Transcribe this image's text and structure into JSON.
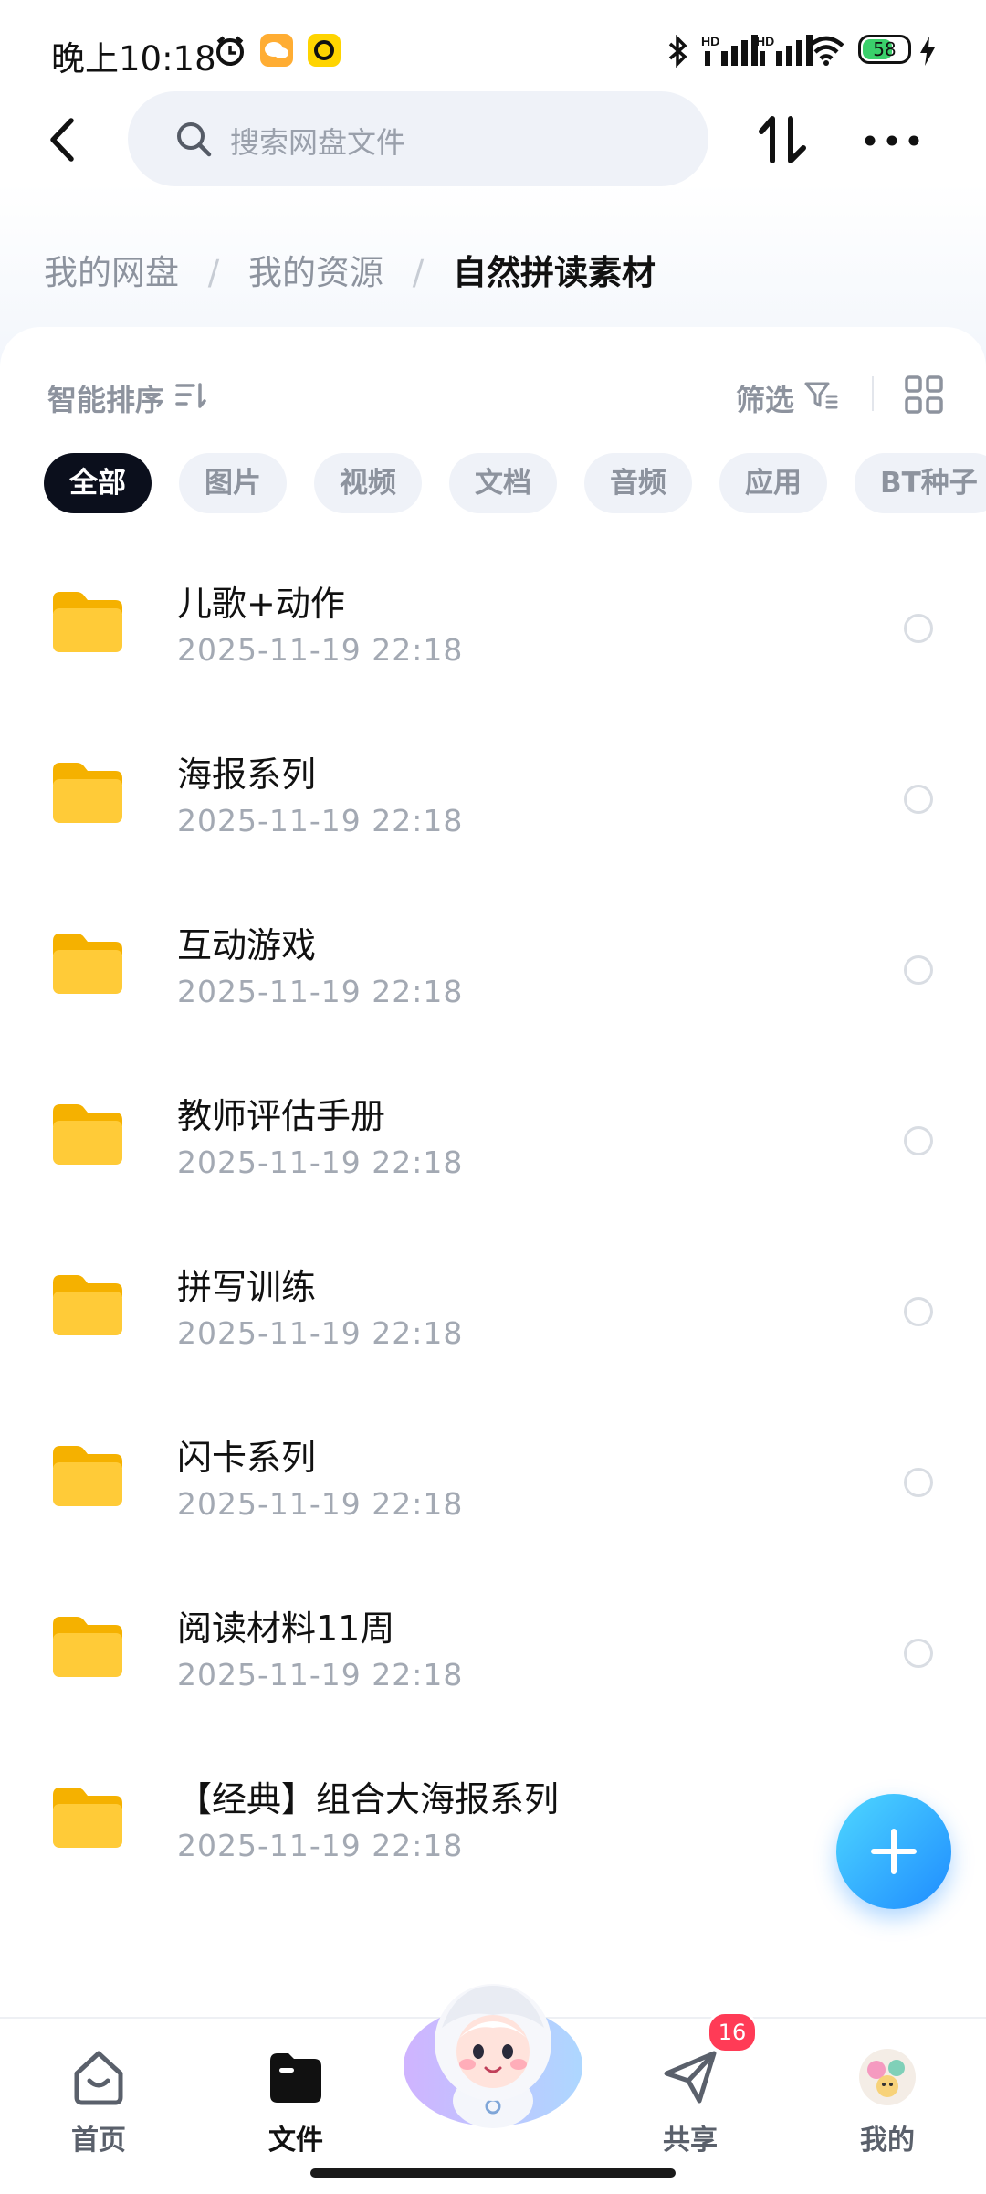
{
  "status_bar": {
    "time": "晚上10:18",
    "battery": "58"
  },
  "header": {
    "search_placeholder": "搜索网盘文件"
  },
  "breadcrumb": {
    "items": [
      "我的网盘",
      "我的资源"
    ],
    "current": "自然拼读素材",
    "separator": "/"
  },
  "toolbar": {
    "sort_label": "智能排序",
    "filter_label": "筛选"
  },
  "filters": [
    {
      "label": "全部",
      "active": true
    },
    {
      "label": "图片",
      "active": false
    },
    {
      "label": "视频",
      "active": false
    },
    {
      "label": "文档",
      "active": false
    },
    {
      "label": "音频",
      "active": false
    },
    {
      "label": "应用",
      "active": false
    },
    {
      "label": "BT种子",
      "active": false
    }
  ],
  "files": [
    {
      "name": "儿歌+动作",
      "date": "2025-11-19  22:18"
    },
    {
      "name": "海报系列",
      "date": "2025-11-19  22:18"
    },
    {
      "name": "互动游戏",
      "date": "2025-11-19  22:18"
    },
    {
      "name": "教师评估手册",
      "date": "2025-11-19  22:18"
    },
    {
      "name": "拼写训练",
      "date": "2025-11-19  22:18"
    },
    {
      "name": "闪卡系列",
      "date": "2025-11-19  22:18"
    },
    {
      "name": "阅读材料11周",
      "date": "2025-11-19  22:18"
    },
    {
      "name": "【经典】组合大海报系列",
      "date": "2025-11-19  22:18"
    }
  ],
  "bottom_nav": {
    "items": [
      {
        "label": "首页",
        "icon": "home-icon"
      },
      {
        "label": "文件",
        "icon": "folder-icon"
      },
      {
        "label": "共享",
        "icon": "send-icon"
      },
      {
        "label": "我的",
        "icon": "avatar-icon"
      }
    ],
    "share_badge": "16"
  },
  "colors": {
    "accent": "#1f8cff",
    "folder": "#ffc83a",
    "badge": "#ff3b56",
    "active_chip": "#0b0f1c"
  }
}
